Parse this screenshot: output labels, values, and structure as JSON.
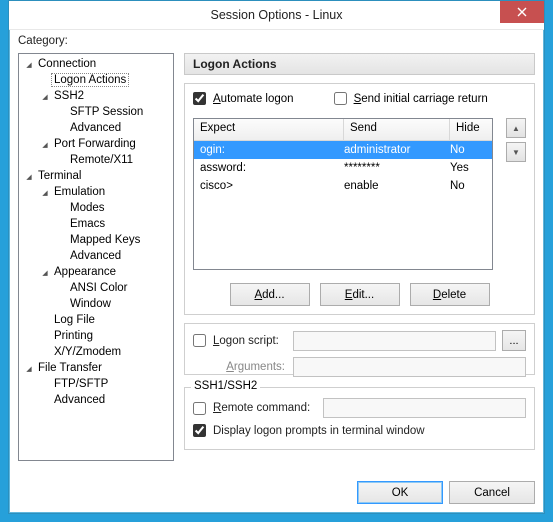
{
  "window": {
    "title": "Session Options - Linux"
  },
  "category_label": "Category:",
  "tree": [
    {
      "label": "Connection",
      "depth": 0,
      "arrow": true
    },
    {
      "label": "Logon Actions",
      "depth": 1,
      "arrow": false,
      "selected": true
    },
    {
      "label": "SSH2",
      "depth": 1,
      "arrow": true
    },
    {
      "label": "SFTP Session",
      "depth": 2,
      "arrow": false
    },
    {
      "label": "Advanced",
      "depth": 2,
      "arrow": false
    },
    {
      "label": "Port Forwarding",
      "depth": 1,
      "arrow": true
    },
    {
      "label": "Remote/X11",
      "depth": 2,
      "arrow": false
    },
    {
      "label": "Terminal",
      "depth": 0,
      "arrow": true
    },
    {
      "label": "Emulation",
      "depth": 1,
      "arrow": true
    },
    {
      "label": "Modes",
      "depth": 2,
      "arrow": false
    },
    {
      "label": "Emacs",
      "depth": 2,
      "arrow": false
    },
    {
      "label": "Mapped Keys",
      "depth": 2,
      "arrow": false
    },
    {
      "label": "Advanced",
      "depth": 2,
      "arrow": false
    },
    {
      "label": "Appearance",
      "depth": 1,
      "arrow": true
    },
    {
      "label": "ANSI Color",
      "depth": 2,
      "arrow": false
    },
    {
      "label": "Window",
      "depth": 2,
      "arrow": false
    },
    {
      "label": "Log File",
      "depth": 1,
      "arrow": false
    },
    {
      "label": "Printing",
      "depth": 1,
      "arrow": false
    },
    {
      "label": "X/Y/Zmodem",
      "depth": 1,
      "arrow": false
    },
    {
      "label": "File Transfer",
      "depth": 0,
      "arrow": true
    },
    {
      "label": "FTP/SFTP",
      "depth": 1,
      "arrow": false
    },
    {
      "label": "Advanced",
      "depth": 1,
      "arrow": false
    }
  ],
  "panel": {
    "heading": "Logon Actions",
    "automate_logon": {
      "label": "Automate logon",
      "checked": true
    },
    "send_initial_cr": {
      "label": "Send initial carriage return",
      "checked": false
    },
    "columns": {
      "expect": "Expect",
      "send": "Send",
      "hide": "Hide"
    },
    "rows": [
      {
        "expect": "ogin:",
        "send": "administrator",
        "hide": "No",
        "selected": true
      },
      {
        "expect": "assword:",
        "send": "********",
        "hide": "Yes",
        "selected": false
      },
      {
        "expect": "cisco>",
        "send": "enable",
        "hide": "No",
        "selected": false
      }
    ],
    "buttons": {
      "add": "Add...",
      "edit": "Edit...",
      "delete": "Delete"
    },
    "logon_script": {
      "label": "Logon script:",
      "checked": false,
      "value": "",
      "browse": "..."
    },
    "arguments": {
      "label": "Arguments:",
      "value": ""
    },
    "ssh_group_label": "SSH1/SSH2",
    "remote_command": {
      "label": "Remote command:",
      "checked": false,
      "value": ""
    },
    "display_prompts": {
      "label": "Display logon prompts in terminal window",
      "checked": true
    }
  },
  "dialog_buttons": {
    "ok": "OK",
    "cancel": "Cancel"
  }
}
